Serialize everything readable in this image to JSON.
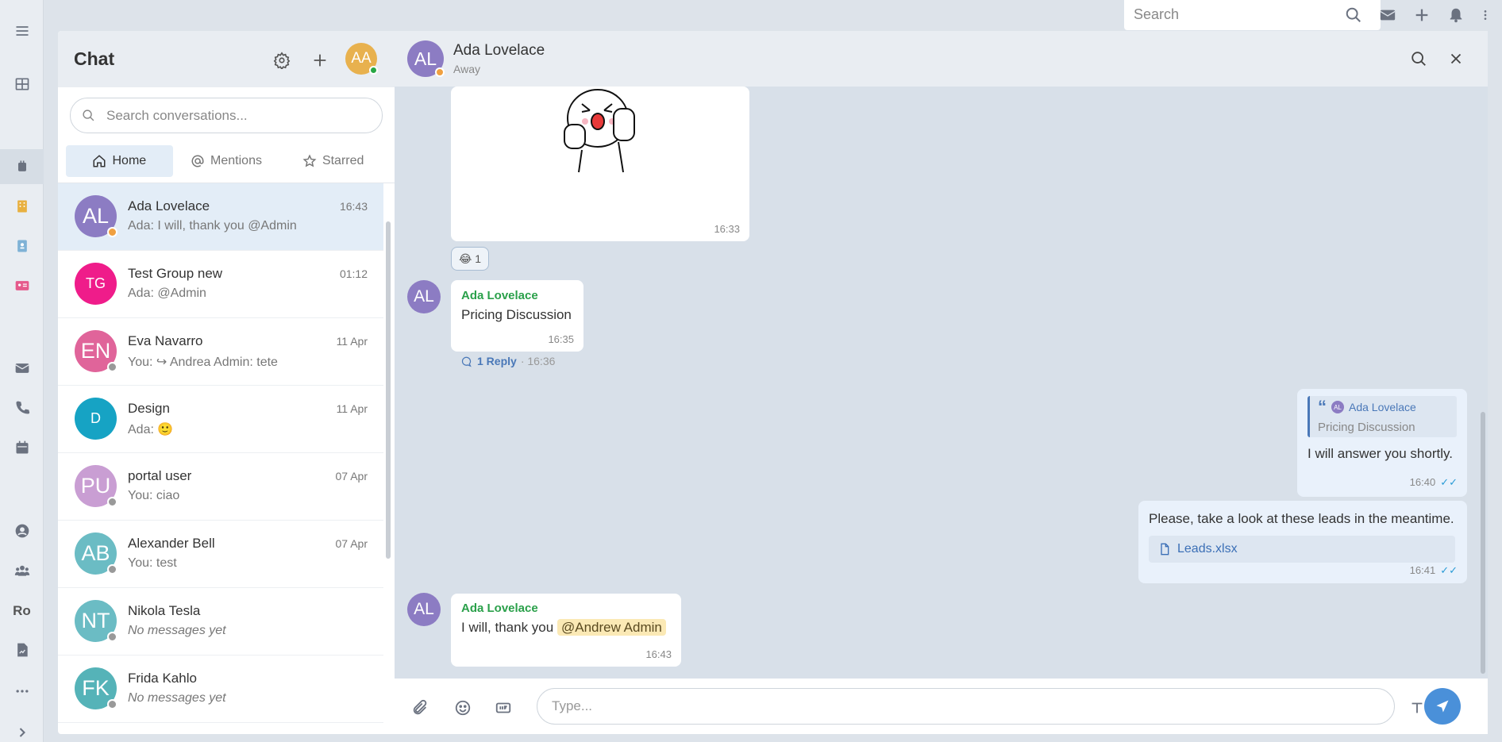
{
  "topbar": {
    "search_placeholder": "Search",
    "icons": [
      "search-icon",
      "mail-icon",
      "plus-icon",
      "bell-icon",
      "kebab-icon"
    ]
  },
  "rail": {
    "text_item": "Ro"
  },
  "chat_panel": {
    "title": "Chat",
    "my_initials": "AA",
    "search_placeholder": "Search conversations...",
    "tabs": [
      {
        "label": "Home"
      },
      {
        "label": "Mentions"
      },
      {
        "label": "Starred"
      }
    ],
    "conversations": [
      {
        "initials": "AL",
        "name": "Ada Lovelace",
        "preview": "Ada: I will, thank you @Admin",
        "time": "16:43",
        "color": "#8c7cc3",
        "status": "#f0a040"
      },
      {
        "initials": "TG",
        "name": "Test Group new",
        "preview": "Ada: @Admin",
        "time": "01:12",
        "color": "#ef1c8a",
        "status": null
      },
      {
        "initials": "EN",
        "name": "Eva Navarro",
        "preview": "You: ↪ Andrea Admin: tete",
        "time": "11 Apr",
        "color": "#e0649a",
        "status": "#999999"
      },
      {
        "initials": "D",
        "name": "Design",
        "preview": "Ada: 🙂",
        "time": "11 Apr",
        "color": "#16a3c4",
        "status": null
      },
      {
        "initials": "PU",
        "name": "portal user",
        "preview": "You: ciao",
        "time": "07 Apr",
        "color": "#c99ed3",
        "status": "#999999"
      },
      {
        "initials": "AB",
        "name": "Alexander Bell",
        "preview": "You: test",
        "time": "07 Apr",
        "color": "#6bbcc4",
        "status": "#999999"
      },
      {
        "initials": "NT",
        "name": "Nikola Tesla",
        "preview": "No messages yet",
        "time": "",
        "color": "#6bbcc4",
        "status": "#999999"
      },
      {
        "initials": "FK",
        "name": "Frida Kahlo",
        "preview": "No messages yet",
        "time": "",
        "color": "#55b3b8",
        "status": "#999999"
      }
    ]
  },
  "thread": {
    "name": "Ada Lovelace",
    "initials": "AL",
    "status": "Away",
    "messages": {
      "sticker_time": "16:33",
      "reaction_emoji": "😂",
      "reaction_count": "1",
      "m1_author": "Ada Lovelace",
      "m1_text": "Pricing Discussion",
      "m1_time": "16:35",
      "m1_reply_label": "1 Reply",
      "m1_reply_time": "· 16:36",
      "m2_quote_author": "Ada Lovelace",
      "m2_quote_text": "Pricing Discussion",
      "m2_text": "I will answer you shortly.",
      "m2_time": "16:40",
      "m3_text": "Please, take a look at these leads in the meantime.",
      "m3_file": "Leads.xlsx",
      "m3_time": "16:41",
      "m4_author": "Ada Lovelace",
      "m4_text": "I will, thank you",
      "m4_mention": "@Andrew Admin",
      "m4_time": "16:43"
    },
    "composer_placeholder": "Type..."
  }
}
